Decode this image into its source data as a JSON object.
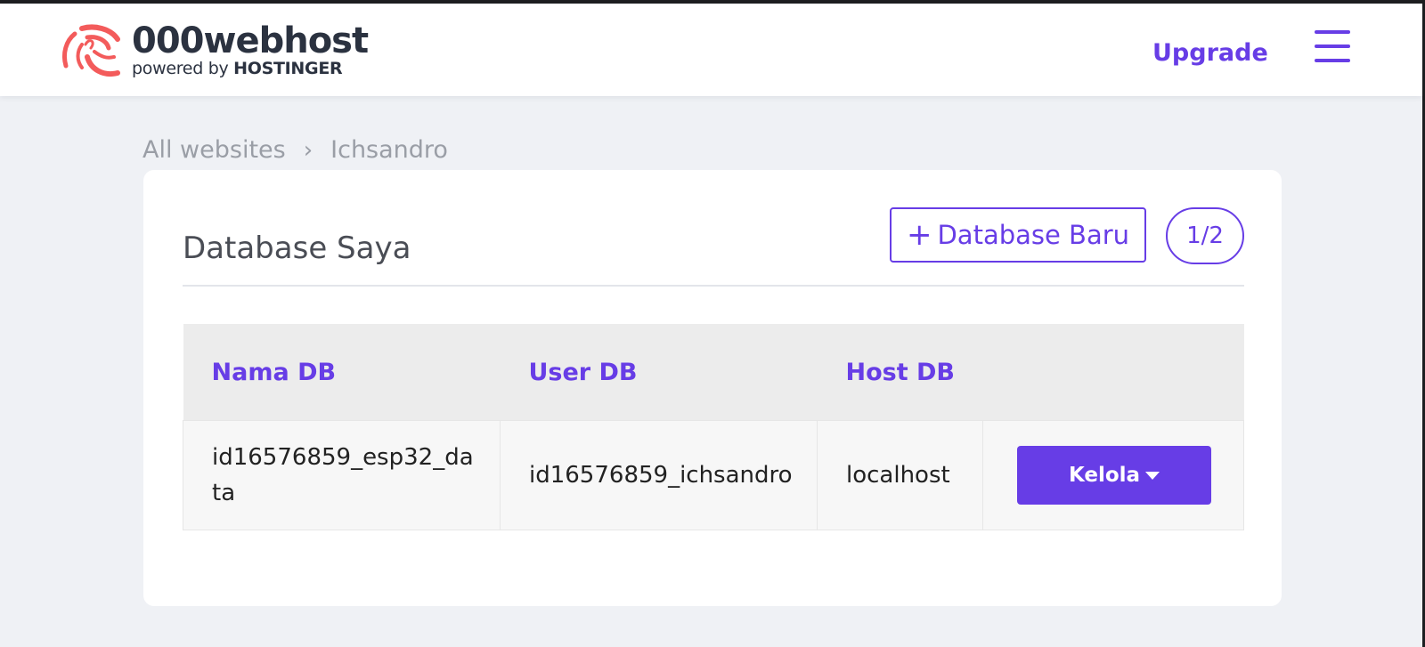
{
  "header": {
    "logo_name": "000webhost",
    "logo_powered": "powered by",
    "logo_brand": "HOSTINGER",
    "upgrade_label": "Upgrade"
  },
  "breadcrumb": {
    "root": "All websites",
    "separator": "›",
    "current": "Ichsandro"
  },
  "card": {
    "title": "Database Saya",
    "new_button_plus": "+",
    "new_button_label": "Database Baru",
    "count": "1/2"
  },
  "table": {
    "headers": [
      "Nama DB",
      "User DB",
      "Host DB"
    ],
    "rows": [
      {
        "name": "id16576859_esp32_data",
        "user": "id16576859_ichsandro",
        "host": "localhost",
        "action_label": "Kelola"
      }
    ]
  },
  "colors": {
    "accent": "#673de6",
    "logo": "#f35b5b",
    "background": "#eff1f5"
  },
  "icons": {
    "logo": "000webhost-swirl-icon",
    "menu": "hamburger-menu-icon",
    "dropdown": "caret-down-icon"
  }
}
